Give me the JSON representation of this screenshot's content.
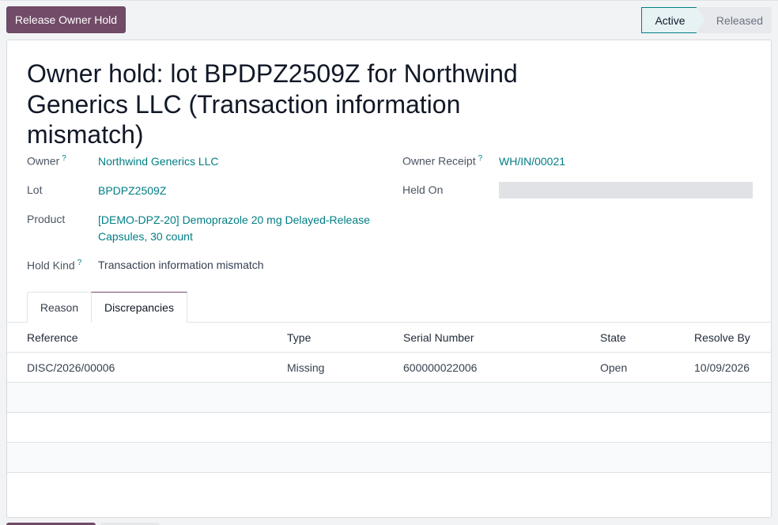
{
  "header": {
    "release_button": "Release Owner Hold",
    "stages": {
      "active": "Active",
      "released": "Released"
    }
  },
  "record": {
    "title": "Owner hold: lot BPDPZ2509Z for Northwind Generics LLC (Transaction information mismatch)",
    "fields": {
      "owner_label": "Owner",
      "owner_value": "Northwind Generics LLC",
      "lot_label": "Lot",
      "lot_value": "BPDPZ2509Z",
      "product_label": "Product",
      "product_value_line1": "[DEMO-DPZ-20] Demoprazole 20 mg Delayed-Release",
      "product_value_line2": "Capsules, 30 count",
      "hold_kind_label": "Hold Kind",
      "hold_kind_value": "Transaction information mismatch",
      "owner_receipt_label": "Owner Receipt",
      "owner_receipt_value": "WH/IN/00021",
      "held_on_label": "Held On",
      "help_mark": "?"
    }
  },
  "tabs": [
    {
      "label": "Reason"
    },
    {
      "label": "Discrepancies"
    }
  ],
  "table": {
    "columns": [
      "Reference",
      "Type",
      "Serial Number",
      "State",
      "Resolve By"
    ],
    "rows": [
      [
        "DISC/2026/00006",
        "Missing",
        "600000022006",
        "Open",
        "10/09/2026"
      ]
    ]
  }
}
